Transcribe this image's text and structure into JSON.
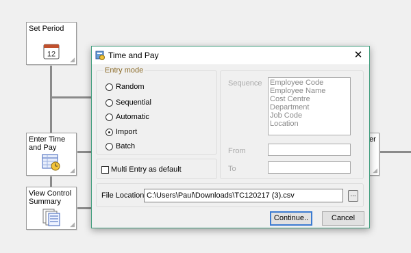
{
  "workflow": {
    "set_period": "Set Period",
    "enter_time_line1": "Enter Time",
    "enter_time_line2": "and Pay",
    "view_control_line1": "View Control",
    "view_control_line2": "Summary",
    "partial_right": "er",
    "calendar_number": "12"
  },
  "dialog": {
    "title": "Time and Pay",
    "close": "✕",
    "entry_mode": {
      "legend": "Entry mode",
      "options": [
        "Random",
        "Sequential",
        "Automatic",
        "Import",
        "Batch"
      ],
      "selected": "Import"
    },
    "multi_entry_label": "Multi Entry as default",
    "multi_entry_checked": false,
    "sequence": {
      "label": "Sequence",
      "items": [
        "Employee Code",
        "Employee Name",
        "Cost Centre",
        "Department",
        "Job Code",
        "Location"
      ]
    },
    "from_label": "From",
    "to_label": "To",
    "file_location": {
      "label": "File Location",
      "value": "C:\\Users\\Paul\\Downloads\\TC120217 (3).csv",
      "browse": "..."
    },
    "buttons": {
      "continue": "Continue..",
      "cancel": "Cancel"
    }
  }
}
